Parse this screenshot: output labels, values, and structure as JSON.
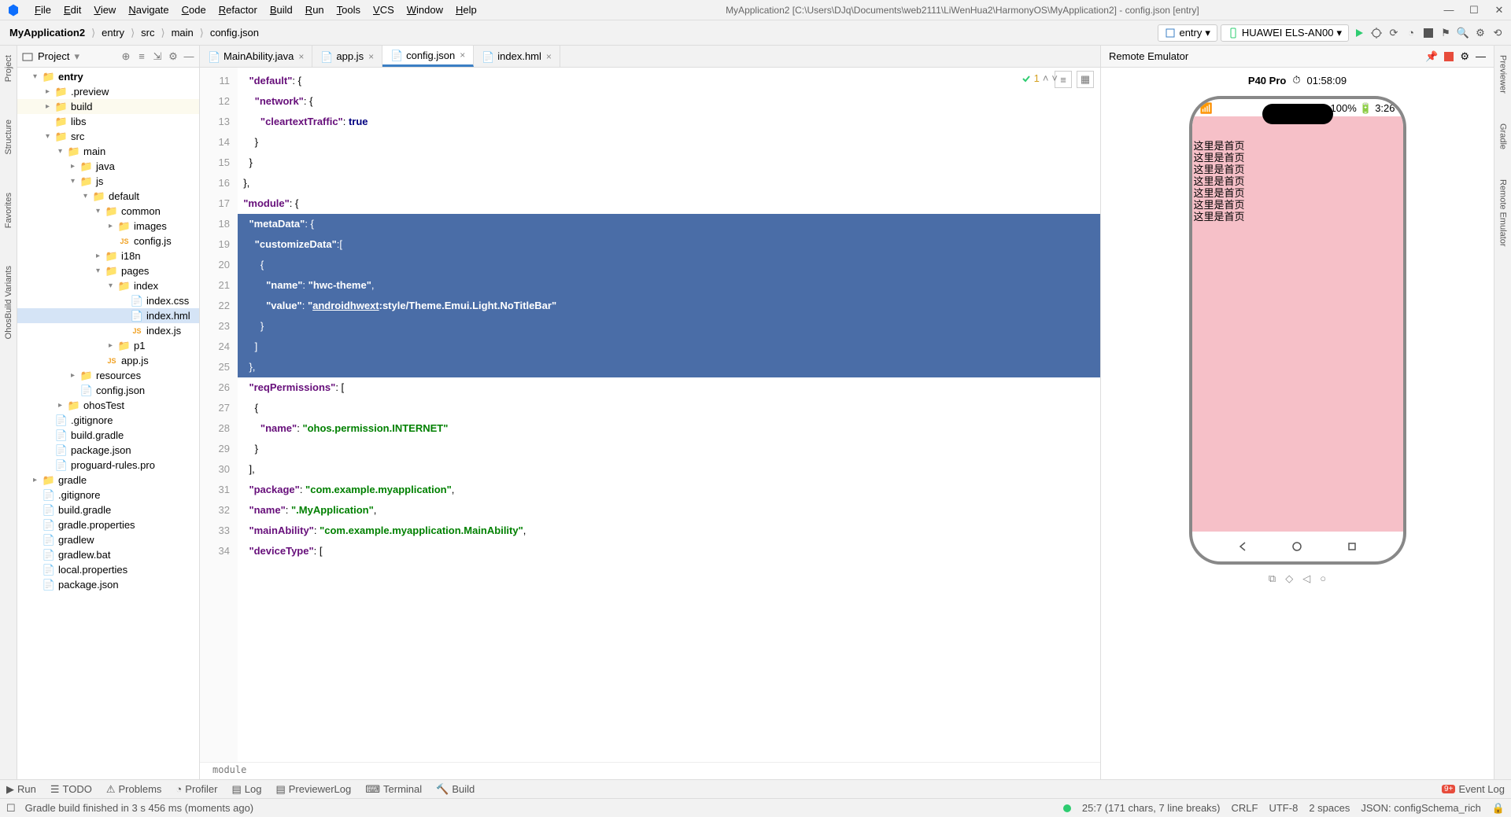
{
  "titlebar": {
    "menus": [
      "File",
      "Edit",
      "View",
      "Navigate",
      "Code",
      "Refactor",
      "Build",
      "Run",
      "Tools",
      "VCS",
      "Window",
      "Help"
    ],
    "title": "MyApplication2 [C:\\Users\\DJq\\Documents\\web2111\\LiWenHua2\\HarmonyOS\\MyApplication2] - config.json [entry]"
  },
  "breadcrumbs": [
    "MyApplication2",
    "entry",
    "src",
    "main",
    "config.json"
  ],
  "run_config": "entry",
  "device": "HUAWEI ELS-AN00",
  "project_label": "Project",
  "tree": [
    {
      "d": 1,
      "ar": "▾",
      "ico": "folder",
      "txt": "entry",
      "bold": true
    },
    {
      "d": 2,
      "ar": "▸",
      "ico": "folder",
      "txt": ".preview"
    },
    {
      "d": 2,
      "ar": "▸",
      "ico": "folder",
      "txt": "build",
      "hl": true
    },
    {
      "d": 2,
      "ar": "",
      "ico": "folder-gray",
      "txt": "libs"
    },
    {
      "d": 2,
      "ar": "▾",
      "ico": "folder-blue",
      "txt": "src"
    },
    {
      "d": 3,
      "ar": "▾",
      "ico": "folder-blue",
      "txt": "main"
    },
    {
      "d": 4,
      "ar": "▸",
      "ico": "folder-blue",
      "txt": "java"
    },
    {
      "d": 4,
      "ar": "▾",
      "ico": "folder-blue",
      "txt": "js"
    },
    {
      "d": 5,
      "ar": "▾",
      "ico": "folder-gray",
      "txt": "default"
    },
    {
      "d": 6,
      "ar": "▾",
      "ico": "folder-gray",
      "txt": "common"
    },
    {
      "d": 7,
      "ar": "▸",
      "ico": "folder-gray",
      "txt": "images"
    },
    {
      "d": 7,
      "ar": "",
      "ico": "jsfile",
      "txt": "config.js"
    },
    {
      "d": 6,
      "ar": "▸",
      "ico": "folder-gray",
      "txt": "i18n"
    },
    {
      "d": 6,
      "ar": "▾",
      "ico": "folder-gray",
      "txt": "pages"
    },
    {
      "d": 7,
      "ar": "▾",
      "ico": "folder-gray",
      "txt": "index"
    },
    {
      "d": 8,
      "ar": "",
      "ico": "file",
      "txt": "index.css"
    },
    {
      "d": 8,
      "ar": "",
      "ico": "file",
      "txt": "index.hml",
      "sel": true
    },
    {
      "d": 8,
      "ar": "",
      "ico": "jsfile",
      "txt": "index.js"
    },
    {
      "d": 7,
      "ar": "▸",
      "ico": "folder-gray",
      "txt": "p1"
    },
    {
      "d": 6,
      "ar": "",
      "ico": "jsfile",
      "txt": "app.js"
    },
    {
      "d": 4,
      "ar": "▸",
      "ico": "folder-gray",
      "txt": "resources"
    },
    {
      "d": 4,
      "ar": "",
      "ico": "file",
      "txt": "config.json"
    },
    {
      "d": 3,
      "ar": "▸",
      "ico": "folder-gray",
      "txt": "ohosTest"
    },
    {
      "d": 2,
      "ar": "",
      "ico": "file",
      "txt": ".gitignore"
    },
    {
      "d": 2,
      "ar": "",
      "ico": "file",
      "txt": "build.gradle"
    },
    {
      "d": 2,
      "ar": "",
      "ico": "file",
      "txt": "package.json"
    },
    {
      "d": 2,
      "ar": "",
      "ico": "file",
      "txt": "proguard-rules.pro"
    },
    {
      "d": 1,
      "ar": "▸",
      "ico": "folder-gray",
      "txt": "gradle"
    },
    {
      "d": 1,
      "ar": "",
      "ico": "file",
      "txt": ".gitignore"
    },
    {
      "d": 1,
      "ar": "",
      "ico": "file",
      "txt": "build.gradle"
    },
    {
      "d": 1,
      "ar": "",
      "ico": "file",
      "txt": "gradle.properties"
    },
    {
      "d": 1,
      "ar": "",
      "ico": "file",
      "txt": "gradlew"
    },
    {
      "d": 1,
      "ar": "",
      "ico": "file",
      "txt": "gradlew.bat"
    },
    {
      "d": 1,
      "ar": "",
      "ico": "file",
      "txt": "local.properties"
    },
    {
      "d": 1,
      "ar": "",
      "ico": "file",
      "txt": "package.json"
    }
  ],
  "tabs": [
    {
      "label": "MainAbility.java",
      "ico": "java",
      "active": false
    },
    {
      "label": "app.js",
      "ico": "js",
      "active": false
    },
    {
      "label": "config.json",
      "ico": "json",
      "active": true
    },
    {
      "label": "index.hml",
      "ico": "hml",
      "active": false
    }
  ],
  "code_lines": [
    {
      "n": 11,
      "html": "    <span class='k'>\"default\"</span><span class='p'>: {</span>"
    },
    {
      "n": 12,
      "html": "      <span class='k'>\"network\"</span><span class='p'>: {</span>"
    },
    {
      "n": 13,
      "html": "        <span class='k'>\"cleartextTraffic\"</span><span class='p'>: </span><span class='b'>true</span>"
    },
    {
      "n": 14,
      "html": "      <span class='p'>}</span>"
    },
    {
      "n": 15,
      "html": "    <span class='p'>}</span>"
    },
    {
      "n": 16,
      "html": "  <span class='p'>},</span>"
    },
    {
      "n": 17,
      "html": "  <span class='k'>\"module\"</span><span class='p'>: {</span>"
    },
    {
      "n": 18,
      "html": "    <span class='k'>\"metaData\"</span><span class='p'>: {</span>",
      "sel": true
    },
    {
      "n": 19,
      "html": "      <span class='k'>\"customizeData\"</span><span class='p'>:[</span>",
      "sel": true
    },
    {
      "n": 20,
      "html": "        <span class='p'>{</span>",
      "sel": true
    },
    {
      "n": 21,
      "html": "          <span class='k'>\"name\"</span><span class='p'>: </span><span class='s'>\"hwc-theme\"</span><span class='p'>,</span>",
      "sel": true
    },
    {
      "n": 22,
      "html": "          <span class='k'>\"value\"</span><span class='p'>: </span><span class='s'>\"<u>androidhwext</u>:style/Theme.Emui.Light.NoTitleBar\"</span>",
      "sel": true
    },
    {
      "n": 23,
      "html": "        <span class='p'>}</span>",
      "sel": true
    },
    {
      "n": 24,
      "html": "      <span class='p'>]</span>",
      "sel": true
    },
    {
      "n": 25,
      "html": "    <span class='p'>},</span>",
      "sel": true,
      "cursor": true
    },
    {
      "n": 26,
      "html": "    <span class='k'>\"reqPermissions\"</span><span class='p'>: [</span>"
    },
    {
      "n": 27,
      "html": "      <span class='p'>{</span>"
    },
    {
      "n": 28,
      "html": "        <span class='k'>\"name\"</span><span class='p'>: </span><span class='s'>\"ohos.permission.INTERNET\"</span>"
    },
    {
      "n": 29,
      "html": "      <span class='p'>}</span>"
    },
    {
      "n": 30,
      "html": "    <span class='p'>],</span>"
    },
    {
      "n": 31,
      "html": "    <span class='k'>\"package\"</span><span class='p'>: </span><span class='s'>\"com.example.myapplication\"</span><span class='p'>,</span>"
    },
    {
      "n": 32,
      "html": "    <span class='k'>\"name\"</span><span class='p'>: </span><span class='s'>\".MyApplication\"</span><span class='p'>,</span>"
    },
    {
      "n": 33,
      "html": "    <span class='k'>\"mainAbility\"</span><span class='p'>: </span><span class='s'>\"com.example.myapplication.MainAbility\"</span><span class='p'>,</span>"
    },
    {
      "n": 34,
      "html": "    <span class='k'>\"deviceType\"</span><span class='p'>: [</span>"
    }
  ],
  "editor_breadcrumb": "module",
  "inspection_count": "1",
  "emulator": {
    "title": "Remote Emulator",
    "device": "P40 Pro",
    "timer": "01:58:09",
    "battery": "100%",
    "time": "3:26",
    "lines": [
      "这里是首页",
      "这里是首页",
      "这里是首页",
      "这里是首页",
      "这里是首页",
      "这里是首页",
      "这里是首页"
    ]
  },
  "leftrail": [
    "Project",
    "Structure",
    "Favorites",
    "OhosBuild Variants"
  ],
  "rightrail": [
    "Previewer",
    "Gradle",
    "Remote Emulator"
  ],
  "bottombar": [
    "Run",
    "TODO",
    "Problems",
    "Profiler",
    "Log",
    "PreviewerLog",
    "Terminal",
    "Build"
  ],
  "event_log": "Event Log",
  "status": {
    "msg": "Gradle build finished in 3 s 456 ms (moments ago)",
    "pos": "25:7 (171 chars, 7 line breaks)",
    "le": "CRLF",
    "enc": "UTF-8",
    "indent": "2 spaces",
    "schema": "JSON: configSchema_rich"
  }
}
